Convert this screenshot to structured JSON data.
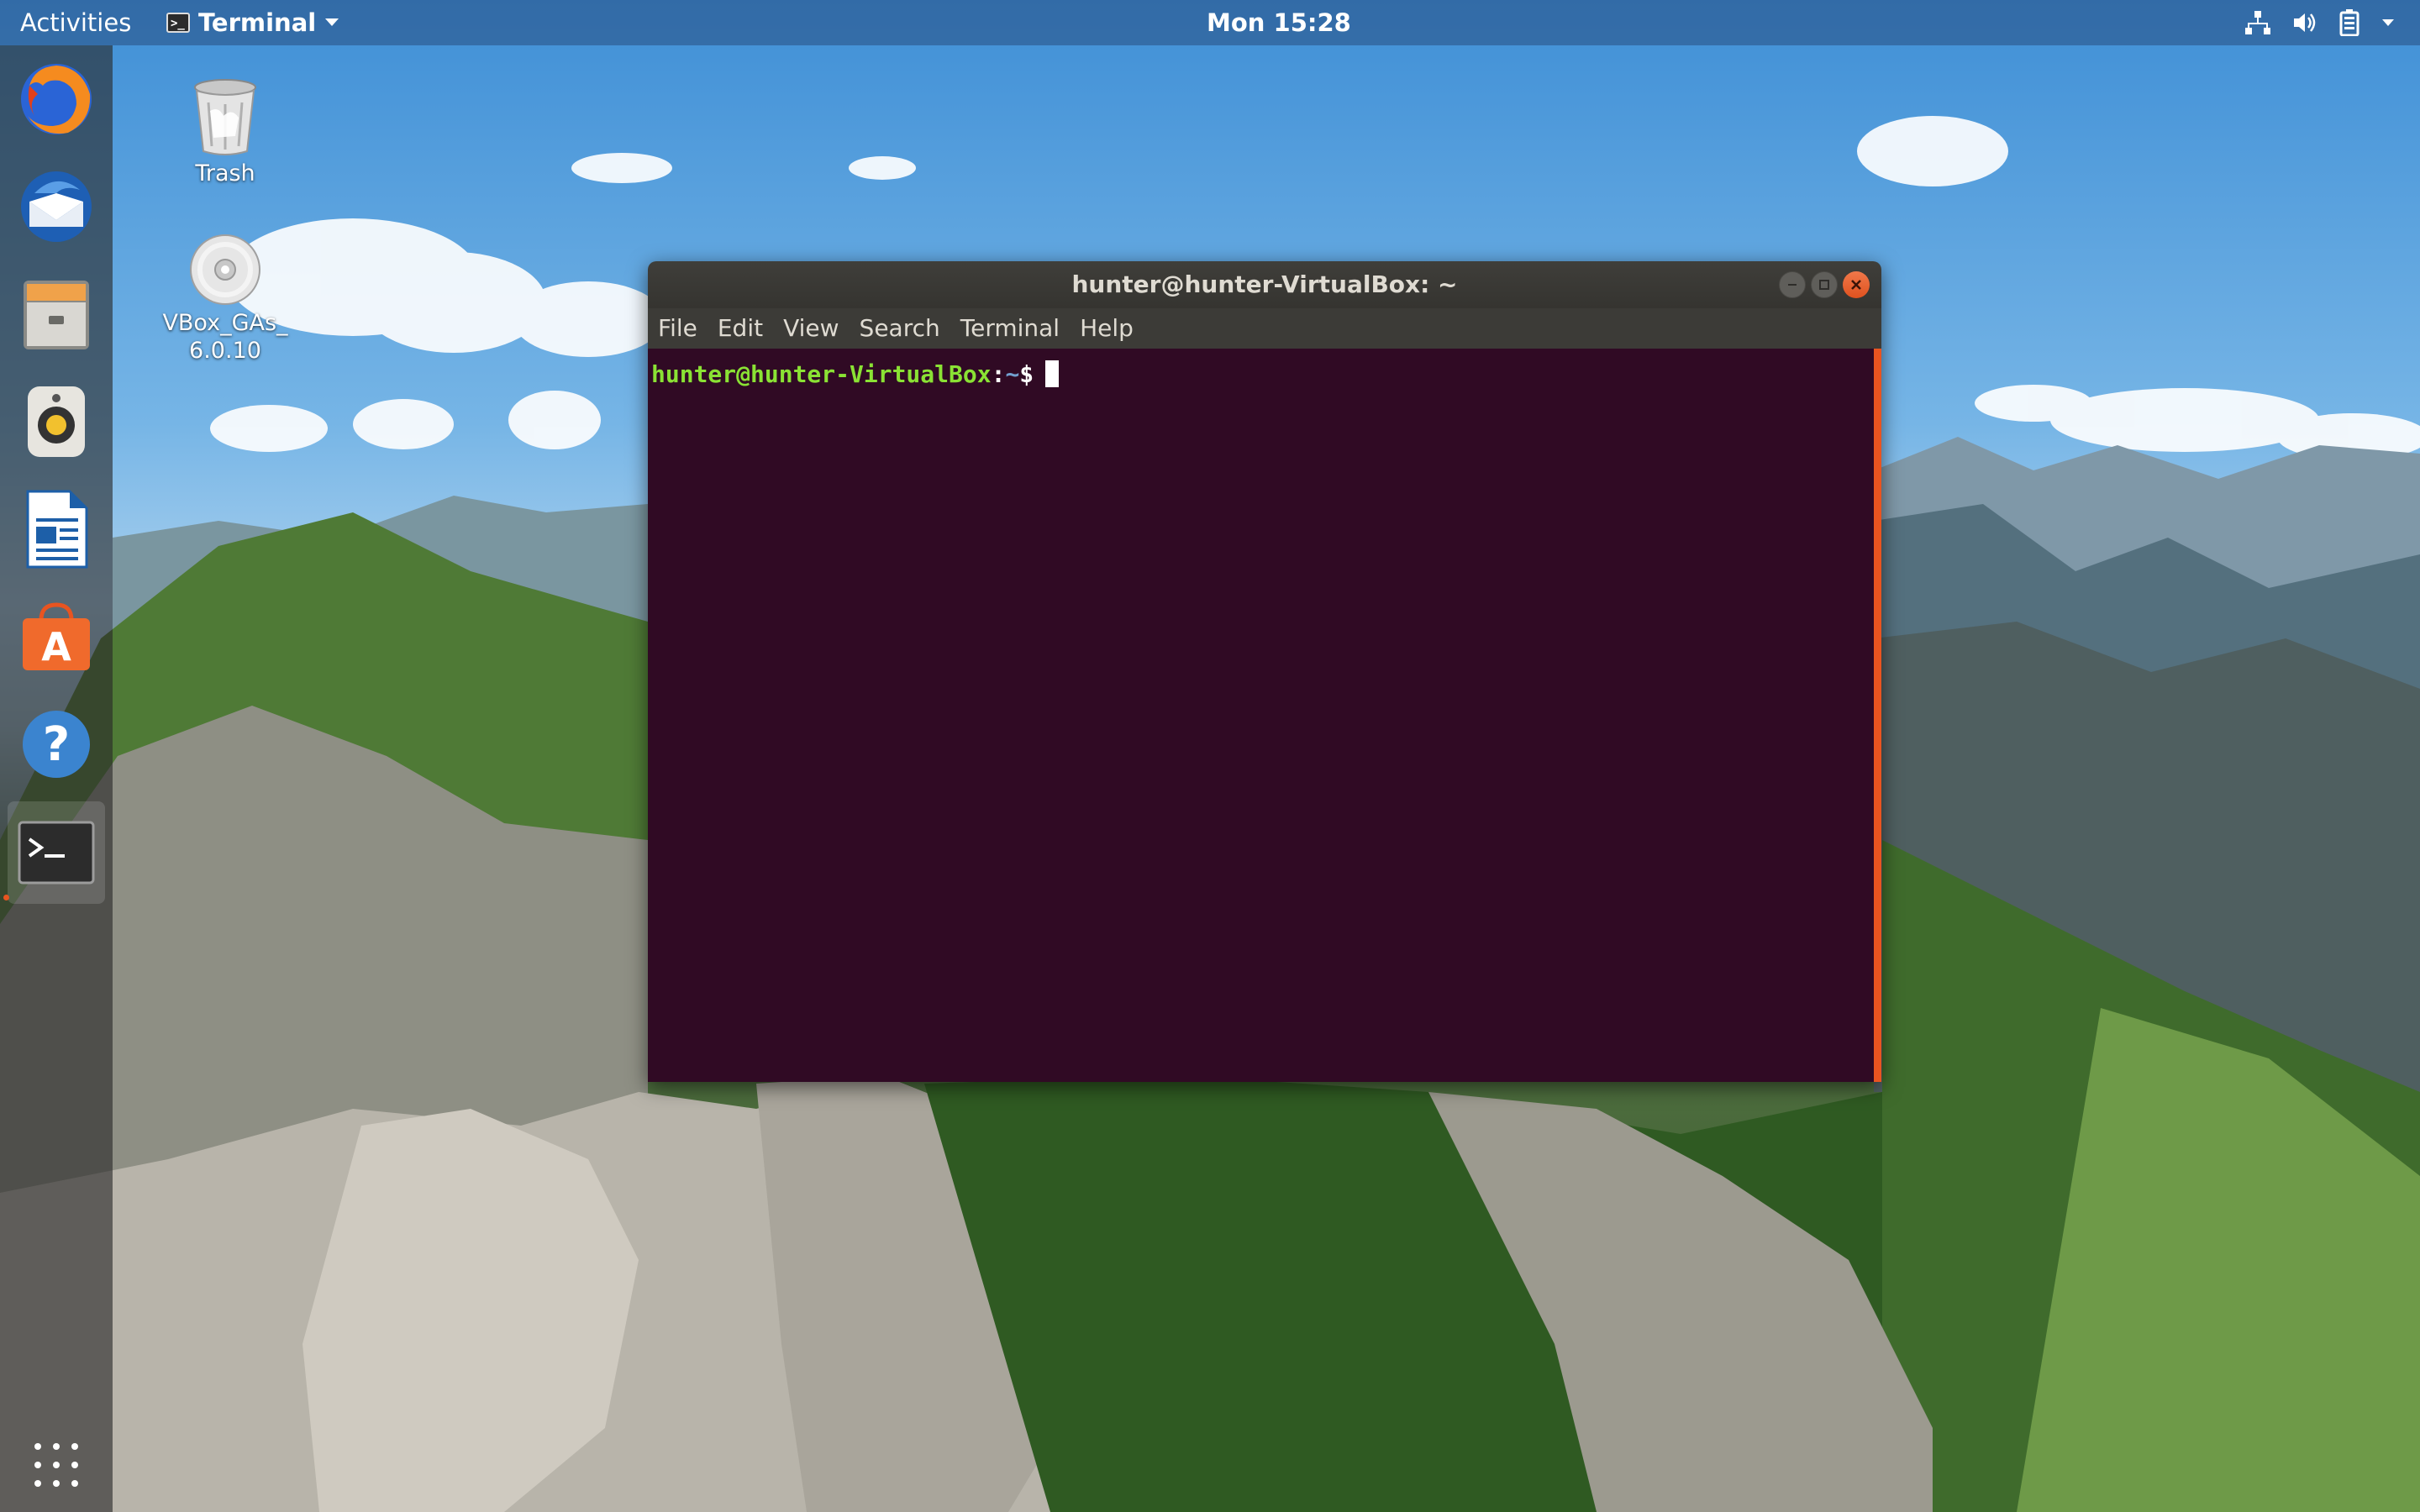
{
  "topbar": {
    "activities": "Activities",
    "app_name": "Terminal",
    "app_icon_glyph": ">_",
    "clock": "Mon 15:28",
    "tray_icons": [
      "network-icon",
      "volume-icon",
      "battery-icon",
      "system-menu-arrow-icon"
    ]
  },
  "dock": {
    "items": [
      {
        "name": "firefox-icon"
      },
      {
        "name": "thunderbird-icon"
      },
      {
        "name": "files-icon"
      },
      {
        "name": "rhythmbox-icon"
      },
      {
        "name": "libreoffice-writer-icon"
      },
      {
        "name": "ubuntu-software-icon"
      },
      {
        "name": "help-icon"
      },
      {
        "name": "terminal-icon",
        "running": true
      }
    ],
    "show_apps_icon": "app-grid-icon"
  },
  "desktop": {
    "icons": [
      {
        "label": "Trash",
        "icon": "trash-icon"
      },
      {
        "label_line1": "VBox_GAs_",
        "label_line2": "6.0.10",
        "icon": "cd-icon"
      }
    ]
  },
  "terminal": {
    "title": "hunter@hunter-VirtualBox: ~",
    "menu": [
      "File",
      "Edit",
      "View",
      "Search",
      "Terminal",
      "Help"
    ],
    "prompt_user": "hunter@hunter-VirtualBox",
    "prompt_colon": ":",
    "prompt_path": "~",
    "prompt_sign": "$",
    "colors": {
      "background": "#300a24",
      "user": "#8ae234",
      "path": "#729fcf",
      "accent": "#e95420"
    }
  }
}
